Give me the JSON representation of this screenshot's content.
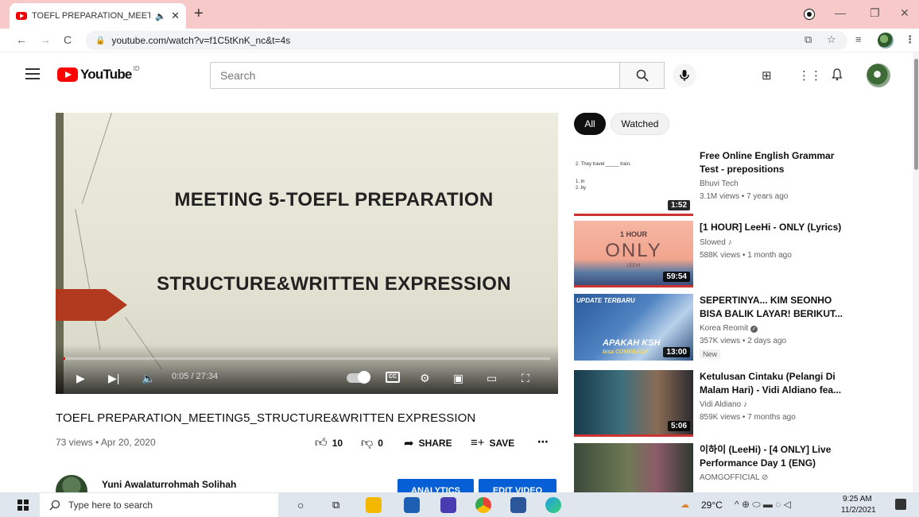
{
  "browser": {
    "tab_title": "TOEFL PREPARATION_MEETI",
    "tab_audio": "🔈",
    "tab_close": "✕",
    "new_tab": "+",
    "url": "youtube.com/watch?v=f1C5tKnK_nc&t=4s",
    "minimize": "—",
    "maximize": "❐",
    "close": "✕"
  },
  "youtube": {
    "logo_text": "YouTube",
    "logo_region": "ID",
    "search_placeholder": "Search"
  },
  "player": {
    "slide_line1": "MEETING 5-TOEFL PREPARATION",
    "slide_line2": "STRUCTURE&WRITTEN EXPRESSION",
    "time": "0:05 / 27:34",
    "progress_fraction": 0.003,
    "cc_label": "CC"
  },
  "video": {
    "title": "TOEFL PREPARATION_MEETING5_STRUCTURE&WRITTEN EXPRESSION",
    "views_date": "73 views • Apr 20, 2020",
    "likes": "10",
    "dislikes": "0",
    "share_label": "SHARE",
    "save_label": "SAVE",
    "more": "⋯",
    "channel_name": "Yuni Awalaturrohmah Solihah",
    "analytics_label": "ANALYTICS",
    "edit_label": "EDIT VIDEO"
  },
  "sidebar": {
    "chips": [
      "All",
      "Watched"
    ],
    "recommendations": [
      {
        "title": "Free Online English Grammar Test - prepositions",
        "channel": "Bhuvi Tech",
        "meta": "3.1M views • 7 years ago",
        "duration": "1:52",
        "thumb_text1": "2. They travel _____ train.",
        "thumb_text2": "1. in",
        "thumb_text3": "2. by"
      },
      {
        "title": "[1 HOUR] LeeHi - ONLY (Lyrics)",
        "channel": "Slowed ♪",
        "meta": "588K views • 1 month ago",
        "duration": "59:54",
        "thumb_text1": "1 HOUR",
        "thumb_text2": "ONLY",
        "thumb_text3": "LEEHI"
      },
      {
        "title": "SEPERTINYA... KIM SEONHO BISA BALIK LAYAR! BERIKUT...",
        "channel": "Korea Reomit",
        "meta": "357K views • 2 days ago",
        "duration": "13:00",
        "badge": "New",
        "thumb_text1": "UPDATE TERBARU",
        "thumb_text2": "APAKAH KSH",
        "thumb_text3": "bisa COMEBACK"
      },
      {
        "title": "Ketulusan Cintaku (Pelangi Di Malam Hari) - Vidi Aldiano fea...",
        "channel": "Vidi Aldiano ♪",
        "meta": "859K views • 7 months ago",
        "duration": "5:06"
      },
      {
        "title": "이하이 (LeeHi) - [4 ONLY] Live Performance Day 1 (ENG)",
        "channel": "AOMGOFFICIAL ⊘",
        "meta": "",
        "duration": ""
      }
    ]
  },
  "taskbar": {
    "search_placeholder": "Type here to search",
    "weather": "29°C",
    "time": "9:25 AM",
    "date": "11/2/2021"
  }
}
